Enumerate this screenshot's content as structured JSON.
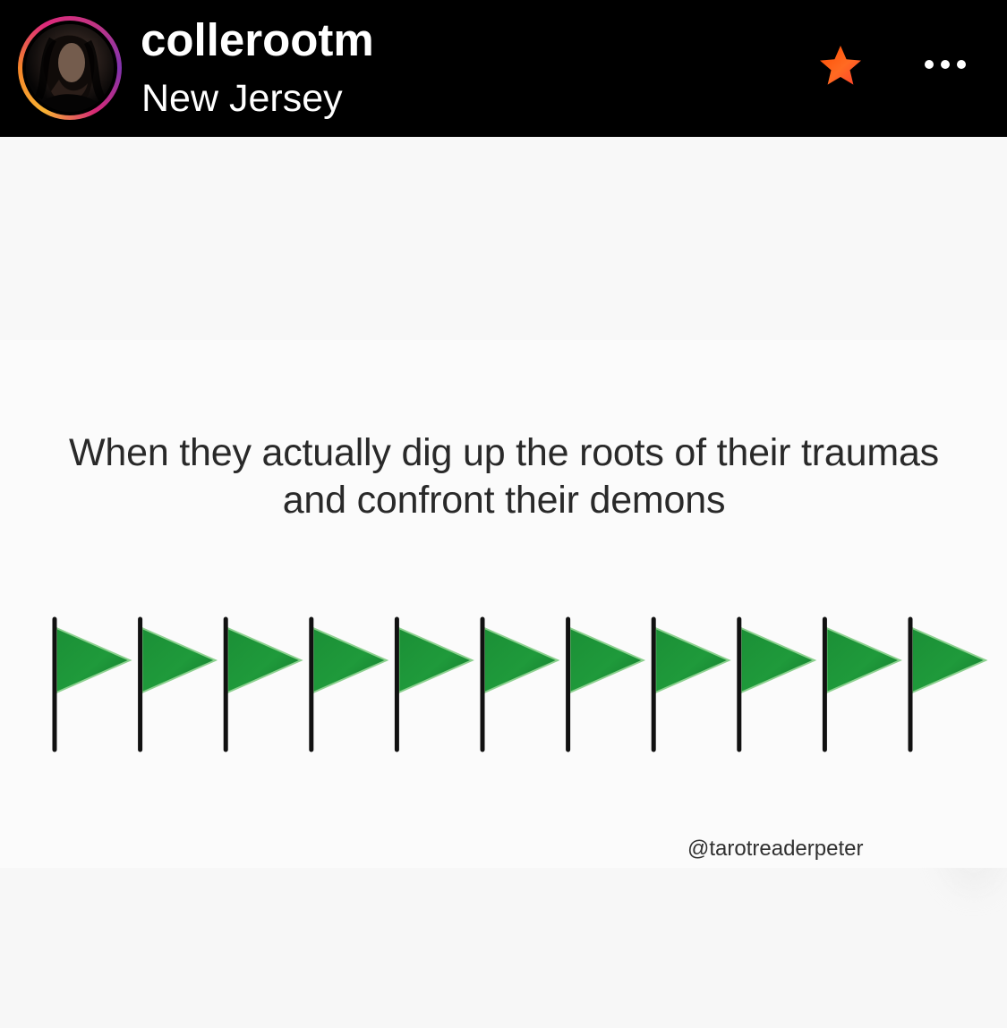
{
  "post": {
    "username": "collerootm",
    "location": "New Jersey",
    "favorite_icon": "star-icon",
    "more_icon": "ellipsis-icon"
  },
  "meme": {
    "caption": "When they actually dig up the roots of their traumas and confront their demons",
    "flag_count": 11,
    "flag_icon": "green-flag-icon",
    "watermark": "@tarotreaderpeter"
  },
  "colors": {
    "header_background": "#000000",
    "post_background": "#f8f8f8",
    "favorite_star": "#ff5a1f",
    "flag_green": "#1f9a3b",
    "flag_pole": "#111111",
    "caption_text": "#292929"
  }
}
